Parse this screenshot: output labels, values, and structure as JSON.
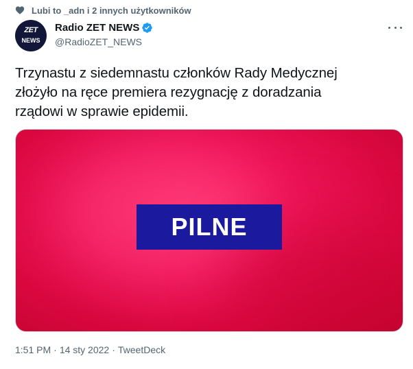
{
  "social_context": {
    "icon": "heart-icon",
    "text": "Lubi to _adn i 2 innych użytkowników"
  },
  "author": {
    "avatar": {
      "logo_line1": "ZET",
      "logo_line2": "NEWS",
      "bg_color": "#12173a"
    },
    "display_name": "Radio ZET NEWS",
    "verified_color": "#1d9bf0",
    "handle": "@RadioZET_NEWS"
  },
  "tweet": {
    "text": "Trzynastu z siedemnastu członków Rady Medycznej\nzłożyło na ręce premiera rezygnację z doradzania\nrządowi w sprawie epidemii."
  },
  "media": {
    "label": "PILNE",
    "bg_color": "#f0155a",
    "box_color": "#1b1a9e"
  },
  "meta": {
    "time": "1:51 PM",
    "separator1": "·",
    "date": "14 sty 2022",
    "separator2": "·",
    "source": "TweetDeck"
  }
}
